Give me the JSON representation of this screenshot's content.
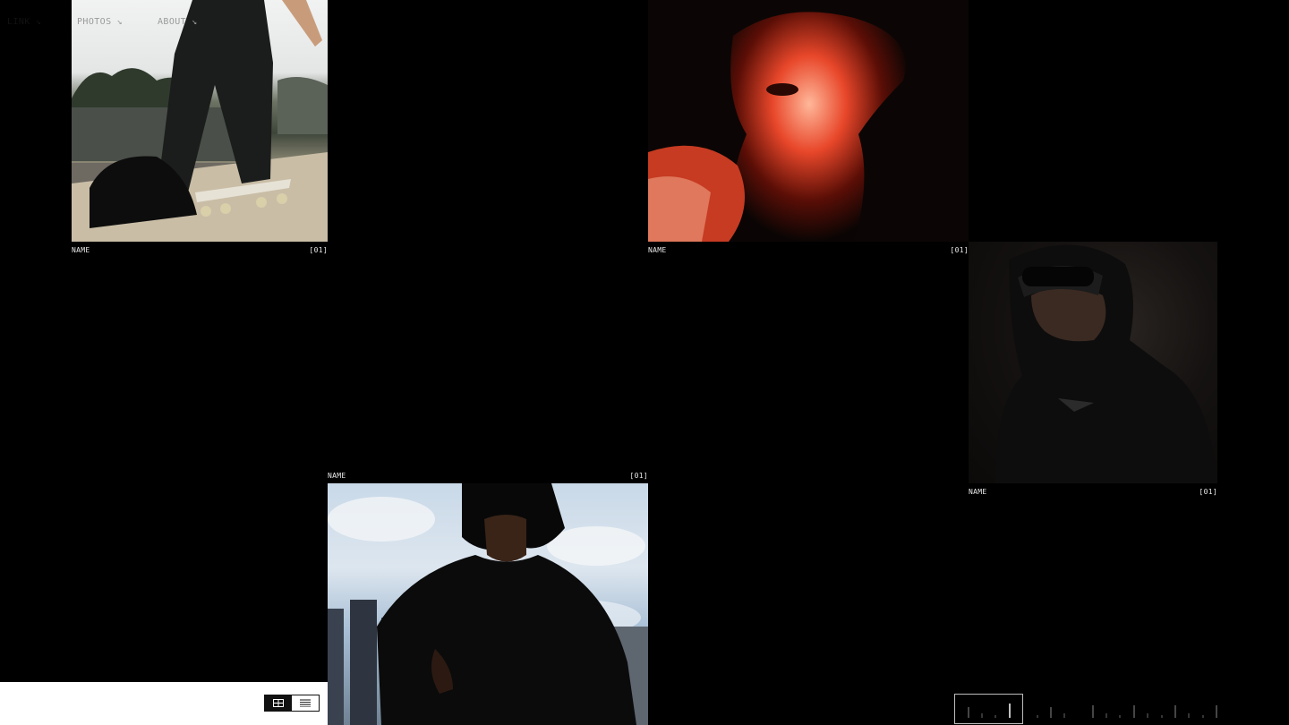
{
  "photos": [
    {
      "name": "NAME",
      "index": "[01]"
    },
    {
      "name": "NAME",
      "index": "[01]"
    },
    {
      "name": "NAME",
      "index": "[01]"
    },
    {
      "name": "NAME",
      "index": "[01]"
    }
  ],
  "nav": {
    "link_label": "LINK",
    "photos_label": "PHOTOS",
    "about_label": "ABOUT",
    "arrow": "↘"
  },
  "view_toggle": {
    "active": "grid",
    "icons": [
      "grid-icon",
      "list-icon"
    ]
  },
  "colors": {
    "background": "#000000",
    "nav_background": "#ffffff",
    "nav_active_text": "#111111",
    "nav_inactive_text": "#9a9a9a",
    "caption_text": "#e8e8e8"
  }
}
